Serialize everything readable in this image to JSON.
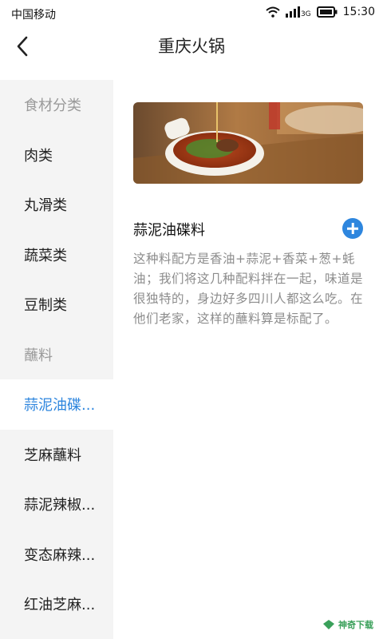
{
  "status_bar": {
    "carrier": "中国移动",
    "network": "3G",
    "time": "15:30"
  },
  "header": {
    "title": "重庆火锅",
    "back_icon": "chevron-left-icon"
  },
  "sidebar": {
    "items": [
      {
        "label": "食材分类",
        "type": "category"
      },
      {
        "label": "肉类",
        "type": "item"
      },
      {
        "label": "丸滑类",
        "type": "item"
      },
      {
        "label": "蔬菜类",
        "type": "item"
      },
      {
        "label": "豆制类",
        "type": "item"
      },
      {
        "label": "蘸料",
        "type": "category"
      },
      {
        "label": "蒜泥油碟...",
        "type": "item",
        "active": true
      },
      {
        "label": "芝麻蘸料",
        "type": "item"
      },
      {
        "label": "蒜泥辣椒...",
        "type": "item"
      },
      {
        "label": "变态麻辣...",
        "type": "item"
      },
      {
        "label": "红油芝麻...",
        "type": "item"
      }
    ]
  },
  "main": {
    "image_alt": "food-photo",
    "title": "蒜泥油碟料",
    "description": "这种料配方是香油+蒜泥+香菜+葱+蚝油；我们将这几种配料拌在一起，味道是很独特的，身边好多四川人都这么吃。在他们老家，这样的蘸料算是标配了。",
    "add_icon": "plus-circle-icon"
  },
  "watermark": {
    "text": "神奇下载"
  },
  "colors": {
    "accent": "#2e86de",
    "sidebar_bg": "#f4f4f4",
    "muted_text": "#8c8c8c"
  }
}
